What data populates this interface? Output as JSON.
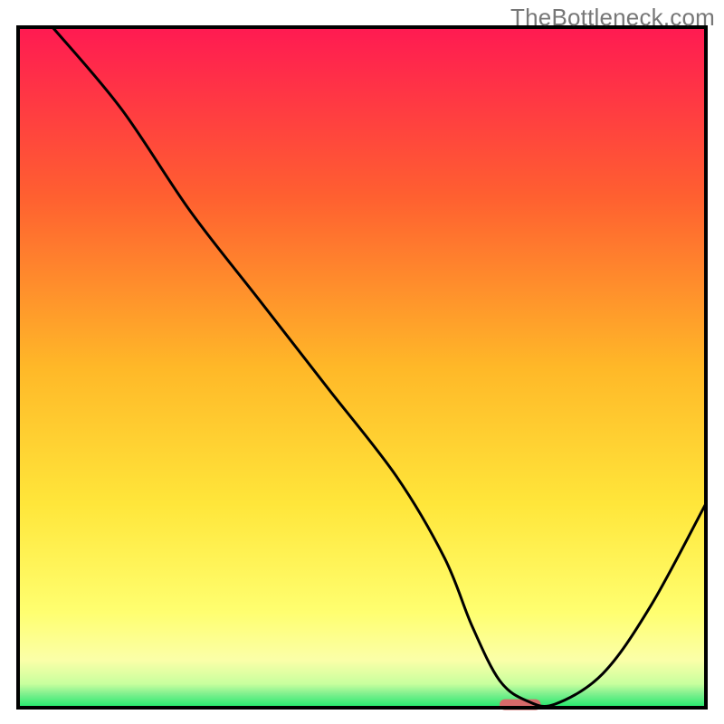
{
  "watermark": "TheBottleneck.com",
  "chart_data": {
    "type": "line",
    "title": "",
    "xlabel": "",
    "ylabel": "",
    "xlim": [
      0,
      100
    ],
    "ylim": [
      0,
      100
    ],
    "grid": false,
    "legend": false,
    "series": [
      {
        "name": "curve",
        "x": [
          5,
          15,
          25,
          35,
          45,
          55,
          62,
          66,
          70,
          74,
          78,
          85,
          92,
          100
        ],
        "values": [
          100,
          88,
          73,
          60,
          47,
          34,
          22,
          12,
          4,
          1,
          0.5,
          5,
          15,
          30
        ]
      }
    ],
    "marker": {
      "x": 73,
      "y": 0.5,
      "width": 6,
      "height": 1.5,
      "color": "#d66a6a"
    },
    "background_gradient": {
      "stops": [
        {
          "offset": 0,
          "color": "#ff1a52"
        },
        {
          "offset": 25,
          "color": "#ff6030"
        },
        {
          "offset": 50,
          "color": "#ffb828"
        },
        {
          "offset": 70,
          "color": "#ffe63a"
        },
        {
          "offset": 86,
          "color": "#ffff70"
        },
        {
          "offset": 93,
          "color": "#fbffa8"
        },
        {
          "offset": 96.5,
          "color": "#c8ff9e"
        },
        {
          "offset": 98,
          "color": "#7ef08e"
        },
        {
          "offset": 100,
          "color": "#1ee86b"
        }
      ]
    }
  }
}
